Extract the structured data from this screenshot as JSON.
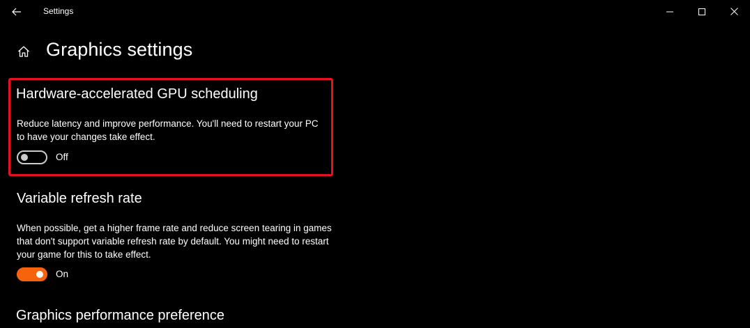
{
  "window": {
    "title": "Settings",
    "icons": {
      "back": "back-arrow-icon",
      "minimize": "minimize-icon",
      "maximize": "maximize-icon",
      "close": "close-icon"
    }
  },
  "header": {
    "title": "Graphics settings",
    "home_icon": "home-icon"
  },
  "sections": [
    {
      "title": "Hardware-accelerated GPU scheduling",
      "description": "Reduce latency and improve performance. You'll need to restart your PC to have your changes take effect.",
      "toggle_state": "Off",
      "highlighted": true
    },
    {
      "title": "Variable refresh rate",
      "description": "When possible, get a higher frame rate and reduce screen tearing in games that don't support variable refresh rate by default. You might need to restart your game for this to take effect.",
      "toggle_state": "On"
    },
    {
      "title": "Graphics performance preference"
    }
  ],
  "colors": {
    "accent": "#f7630c",
    "highlight": "#e81123",
    "background": "#000000"
  }
}
